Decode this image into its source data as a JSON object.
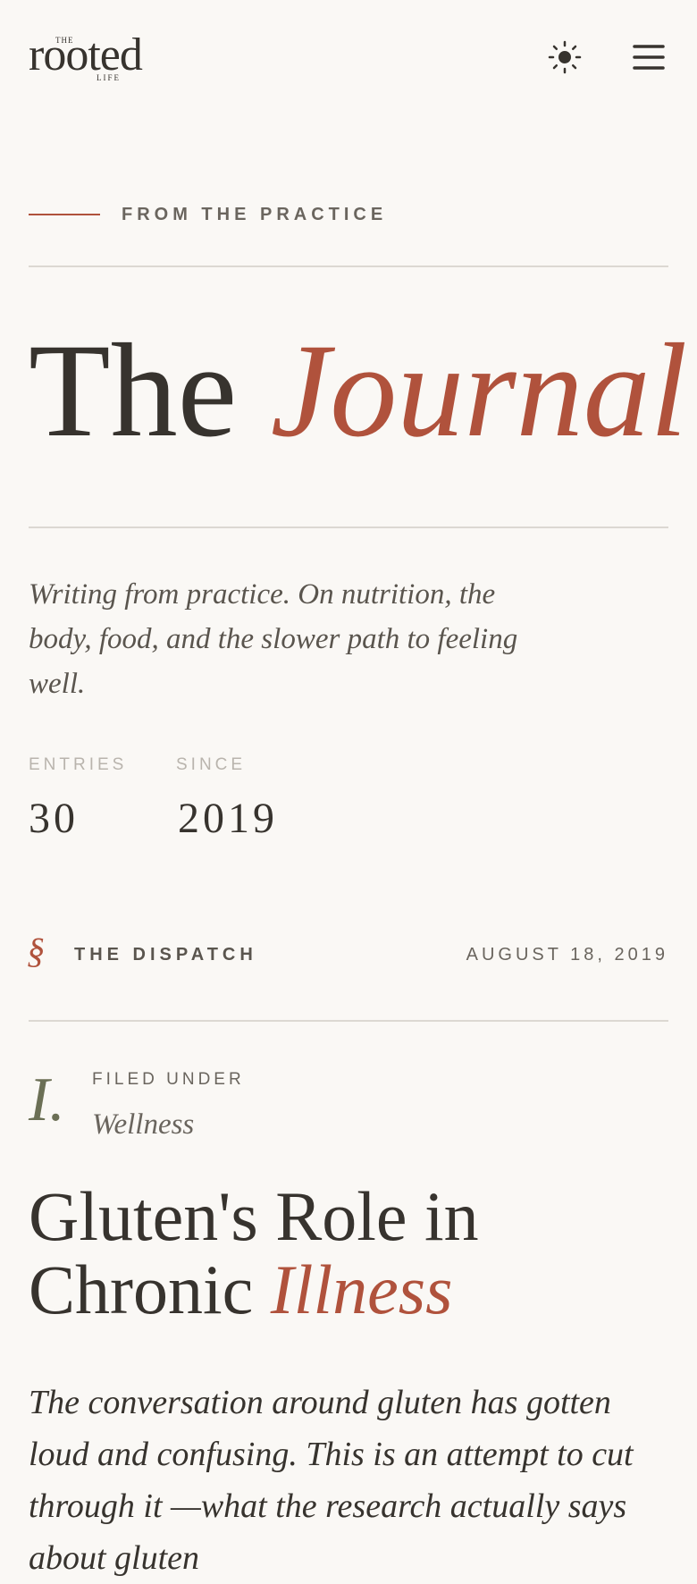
{
  "header": {
    "logo": {
      "top": "THE",
      "main": "rooted",
      "bottom": "LIFE"
    },
    "theme_toggle_icon": "sun-icon",
    "menu_icon": "hamburger-menu-icon"
  },
  "eyebrow": "FROM THE PRACTICE",
  "hero": {
    "title_plain": "The",
    "title_accent": "Journal",
    "intro": "Writing from practice. On nutrition, the body, food, and the slower path to feeling well."
  },
  "stats": [
    {
      "label": "ENTRIES",
      "value": "30"
    },
    {
      "label": "SINCE",
      "value": "2019"
    }
  ],
  "dispatch": {
    "mark": "§",
    "label": "THE DISPATCH",
    "date": "AUGUST 18, 2019"
  },
  "article": {
    "numeral": "I.",
    "filed_label": "FILED UNDER",
    "category": "Wellness",
    "title_plain": "Gluten's Role in Chronic",
    "title_accent": "Illness",
    "excerpt": "The conversation around gluten has gotten loud and confusing. This is an attempt to cut through it —what the research actually says about gluten"
  },
  "colors": {
    "background": "#faf8f5",
    "text": "#37332e",
    "accent": "#b0523c",
    "muted": "#6a655e",
    "olive": "#6b6f55"
  }
}
